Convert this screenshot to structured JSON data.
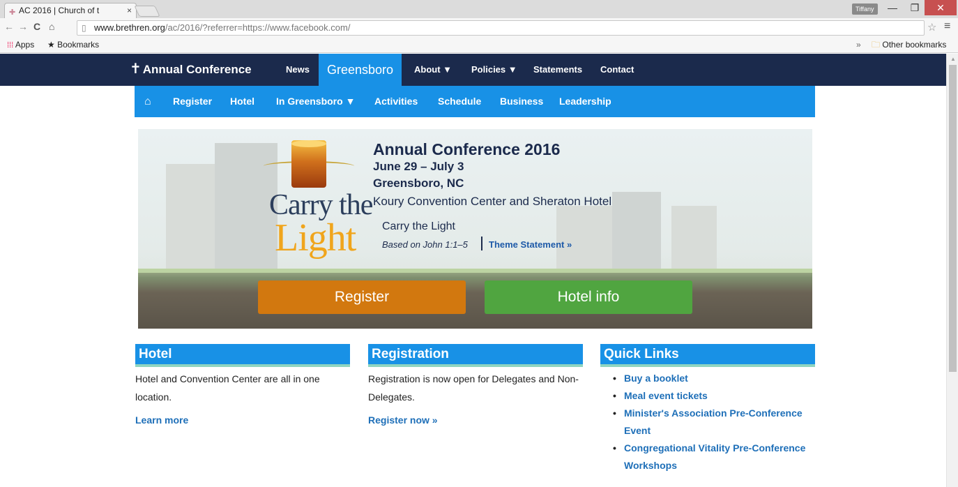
{
  "browser": {
    "tab_title": "AC 2016 | Church of t",
    "profile": "Tiffany",
    "url_host": "www.brethren.org",
    "url_rest": "/ac/2016/?referrer=https://www.facebook.com/",
    "bookmarks": {
      "apps": "Apps",
      "bookmarks": "Bookmarks",
      "overflow": "»",
      "other": "Other bookmarks"
    }
  },
  "topnav": {
    "logo": "Annual Conference",
    "items": [
      "News",
      "Greensboro",
      "About ▼",
      "Policies ▼",
      "Statements",
      "Contact"
    ],
    "active_index": 1
  },
  "subnav": {
    "home_icon": "home-icon",
    "items": [
      "Register",
      "Hotel",
      "In Greensboro ▼",
      "Activities",
      "Schedule",
      "Business",
      "Leadership"
    ]
  },
  "hero": {
    "logo_line1": "Carry the",
    "logo_line2": "Light",
    "title": "Annual Conference 2016",
    "dates": "June 29 – July 3",
    "city": "Greensboro, NC",
    "venue": "Koury Convention Center and Sheraton Hotel",
    "theme": "Carry the Light",
    "scripture": "Based on John 1:1–5",
    "theme_link": "Theme Statement »",
    "btn_register": "Register",
    "btn_hotel": "Hotel info",
    "colors": {
      "register": "#d2780f",
      "hotel": "#50a540"
    }
  },
  "columns": {
    "hotel": {
      "heading": "Hotel",
      "text": "Hotel and Convention Center are all in one location.",
      "link": "Learn more"
    },
    "registration": {
      "heading": "Registration",
      "text": "Registration is now open for Delegates and Non-Delegates.",
      "link": "Register now »"
    },
    "quick_links": {
      "heading": "Quick Links",
      "items": [
        "Buy a booklet",
        "Meal event tickets",
        "Minister's Association Pre-Conference Event",
        "Congregational Vitality Pre-Conference Workshops"
      ]
    }
  },
  "colors": {
    "nav_dark": "#1b2a4c",
    "accent_blue": "#1891e6",
    "link": "#1e6fb8"
  }
}
